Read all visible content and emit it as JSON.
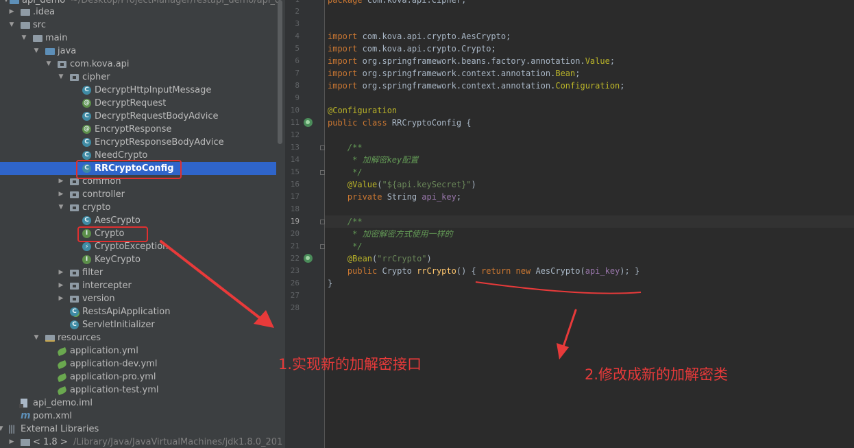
{
  "project_tree": {
    "root_label": "api_demo",
    "root_path": "~/Desktop/ProjectManager/restapi_demo/api_d",
    "items": [
      {
        "label": "api_demo",
        "path": "~/Desktop/ProjectManager/restapi_demo/api_d",
        "icon": "module-folder-icon"
      },
      {
        "label": ".idea",
        "icon": "folder-icon"
      },
      {
        "label": "src",
        "icon": "folder-icon"
      },
      {
        "label": "main",
        "icon": "folder-icon"
      },
      {
        "label": "java",
        "icon": "source-folder-icon"
      },
      {
        "label": "com.kova.api",
        "icon": "package-icon"
      },
      {
        "label": "cipher",
        "icon": "package-icon"
      },
      {
        "label": "DecryptHttpInputMessage",
        "icon": "class-icon"
      },
      {
        "label": "DecryptRequest",
        "icon": "annotation-icon"
      },
      {
        "label": "DecryptRequestBodyAdvice",
        "icon": "class-icon"
      },
      {
        "label": "EncryptResponse",
        "icon": "annotation-icon"
      },
      {
        "label": "EncryptResponseBodyAdvice",
        "icon": "class-icon"
      },
      {
        "label": "NeedCrypto",
        "icon": "class-icon"
      },
      {
        "label": "RRCryptoConfig",
        "icon": "class-icon",
        "selected": true
      },
      {
        "label": "common",
        "icon": "package-icon"
      },
      {
        "label": "controller",
        "icon": "package-icon"
      },
      {
        "label": "crypto",
        "icon": "package-icon"
      },
      {
        "label": "AesCrypto",
        "icon": "class-icon"
      },
      {
        "label": "Crypto",
        "icon": "interface-icon"
      },
      {
        "label": "CryptoException",
        "icon": "exception-icon"
      },
      {
        "label": "KeyCrypto",
        "icon": "interface-icon"
      },
      {
        "label": "filter",
        "icon": "package-icon"
      },
      {
        "label": "intercepter",
        "icon": "package-icon"
      },
      {
        "label": "version",
        "icon": "package-icon"
      },
      {
        "label": "RestsApiApplication",
        "icon": "spring-boot-class-icon"
      },
      {
        "label": "ServletInitializer",
        "icon": "class-icon"
      },
      {
        "label": "resources",
        "icon": "resources-folder-icon"
      },
      {
        "label": "application.yml",
        "icon": "yaml-icon"
      },
      {
        "label": "application-dev.yml",
        "icon": "yaml-icon"
      },
      {
        "label": "application-pro.yml",
        "icon": "yaml-icon"
      },
      {
        "label": "application-test.yml",
        "icon": "yaml-icon"
      },
      {
        "label": "api_demo.iml",
        "icon": "iml-file-icon"
      },
      {
        "label": "pom.xml",
        "icon": "maven-icon"
      },
      {
        "label": "External Libraries",
        "icon": "libraries-icon"
      },
      {
        "label": "< 1.8 >",
        "path": "/Library/Java/JavaVirtualMachines/jdk1.8.0_201",
        "icon": "jdk-icon"
      }
    ]
  },
  "editor": {
    "current_line": "19",
    "lines": [
      {
        "n": "1",
        "tokens": [
          {
            "t": "package ",
            "c": "kw"
          },
          {
            "t": "com.kova.api.cipher;",
            "c": ""
          }
        ]
      },
      {
        "n": "2",
        "tokens": []
      },
      {
        "n": "3",
        "tokens": []
      },
      {
        "n": "4",
        "tokens": [
          {
            "t": "import ",
            "c": "kw"
          },
          {
            "t": "com.kova.api.crypto.AesCrypto;",
            "c": ""
          }
        ]
      },
      {
        "n": "5",
        "tokens": [
          {
            "t": "import ",
            "c": "kw"
          },
          {
            "t": "com.kova.api.crypto.Crypto;",
            "c": ""
          }
        ]
      },
      {
        "n": "6",
        "tokens": [
          {
            "t": "import ",
            "c": "kw"
          },
          {
            "t": "org.springframework.beans.factory.annotation.",
            "c": ""
          },
          {
            "t": "Value",
            "c": "ann"
          },
          {
            "t": ";",
            "c": ""
          }
        ]
      },
      {
        "n": "7",
        "tokens": [
          {
            "t": "import ",
            "c": "kw"
          },
          {
            "t": "org.springframework.context.annotation.",
            "c": ""
          },
          {
            "t": "Bean",
            "c": "ann"
          },
          {
            "t": ";",
            "c": ""
          }
        ]
      },
      {
        "n": "8",
        "tokens": [
          {
            "t": "import ",
            "c": "kw"
          },
          {
            "t": "org.springframework.context.annotation.",
            "c": ""
          },
          {
            "t": "Configuration",
            "c": "ann"
          },
          {
            "t": ";",
            "c": ""
          }
        ]
      },
      {
        "n": "9",
        "tokens": []
      },
      {
        "n": "10",
        "tokens": [
          {
            "t": "@Configuration",
            "c": "ann"
          }
        ]
      },
      {
        "n": "11",
        "tokens": [
          {
            "t": "public class ",
            "c": "kw"
          },
          {
            "t": "RRCryptoConfig {",
            "c": ""
          }
        ]
      },
      {
        "n": "12",
        "tokens": []
      },
      {
        "n": "13",
        "tokens": [
          {
            "t": "    /**",
            "c": "com"
          }
        ]
      },
      {
        "n": "14",
        "tokens": [
          {
            "t": "     * 加解密key配置",
            "c": "com"
          }
        ]
      },
      {
        "n": "15",
        "tokens": [
          {
            "t": "     */",
            "c": "com"
          }
        ]
      },
      {
        "n": "16",
        "tokens": [
          {
            "t": "    @Value",
            "c": "ann"
          },
          {
            "t": "(",
            "c": ""
          },
          {
            "t": "\"${api.keySecret}\"",
            "c": "str"
          },
          {
            "t": ")",
            "c": ""
          }
        ]
      },
      {
        "n": "17",
        "tokens": [
          {
            "t": "    private ",
            "c": "kw"
          },
          {
            "t": "String ",
            "c": ""
          },
          {
            "t": "api_key",
            "c": "fld"
          },
          {
            "t": ";",
            "c": ""
          }
        ]
      },
      {
        "n": "18",
        "tokens": []
      },
      {
        "n": "19",
        "tokens": [
          {
            "t": "    /**",
            "c": "com"
          }
        ]
      },
      {
        "n": "20",
        "tokens": [
          {
            "t": "     * 加密解密方式使用一样的",
            "c": "com"
          }
        ]
      },
      {
        "n": "21",
        "tokens": [
          {
            "t": "     */",
            "c": "com"
          }
        ]
      },
      {
        "n": "22",
        "tokens": [
          {
            "t": "    @Bean",
            "c": "ann"
          },
          {
            "t": "(",
            "c": ""
          },
          {
            "t": "\"rrCrypto\"",
            "c": "str"
          },
          {
            "t": ")",
            "c": ""
          }
        ]
      },
      {
        "n": "23",
        "tokens": [
          {
            "t": "    public ",
            "c": "kw"
          },
          {
            "t": "Crypto ",
            "c": ""
          },
          {
            "t": "rrCrypto",
            "c": "mth"
          },
          {
            "t": "() { ",
            "c": ""
          },
          {
            "t": "return new ",
            "c": "kw"
          },
          {
            "t": "AesCrypto(",
            "c": ""
          },
          {
            "t": "api_key",
            "c": "fld"
          },
          {
            "t": "); }",
            "c": ""
          }
        ]
      },
      {
        "n": "26",
        "tokens": [
          {
            "t": "}",
            "c": ""
          }
        ]
      },
      {
        "n": "27",
        "tokens": []
      },
      {
        "n": "28",
        "tokens": []
      }
    ]
  },
  "annotations": {
    "note1": "1.实现新的加解密接口",
    "note2": "2.修改成新的加解密类",
    "color": "#e03030"
  }
}
